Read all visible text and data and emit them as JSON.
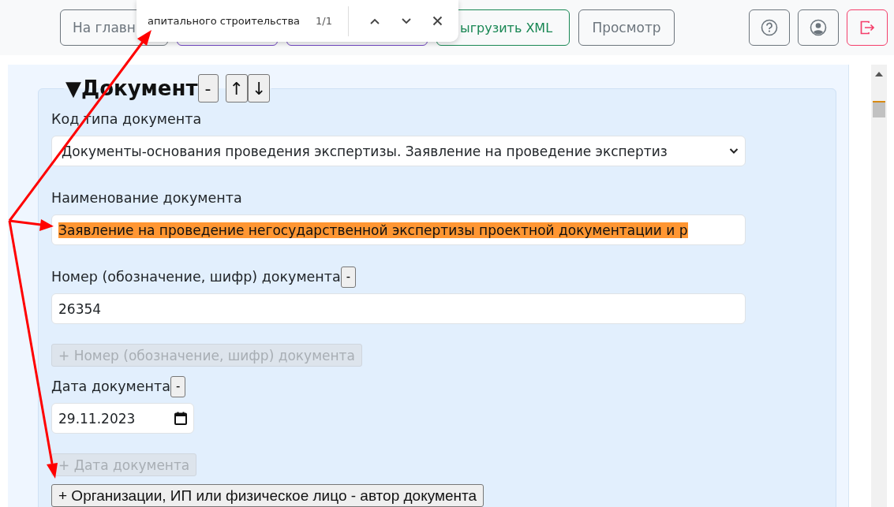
{
  "toolbar": {
    "buttons": [
      {
        "kind": "secondary",
        "label": "На главн"
      },
      {
        "kind": "primary"
      },
      {
        "kind": "primary"
      },
      {
        "kind": "success",
        "label": "ыгрузить XML"
      },
      {
        "kind": "secondary",
        "label": "Просмотр"
      }
    ],
    "icon_buttons": [
      {
        "kind": "help"
      },
      {
        "kind": "profile"
      },
      {
        "kind": "logout"
      }
    ]
  },
  "find_bar": {
    "query": "апитального строительства",
    "count": "1/1"
  },
  "section": {
    "toggle": "▼",
    "title": "Документ",
    "controls": [
      "-",
      "↑",
      "↓"
    ]
  },
  "fields": [
    {
      "kind": "select",
      "label": "Код типа документа",
      "value": "Документы-основания проведения экспертизы. Заявление на проведение экспертиз"
    },
    {
      "kind": "text",
      "label": "Наименование документа",
      "value": "Заявление на проведение негосударственной экспертизы проектной документации и р",
      "highlighted": true
    },
    {
      "kind": "text",
      "label": "Номер (обозначение, шифр) документа",
      "remove": "-",
      "value": "26354",
      "highlighted": false
    },
    {
      "kind": "add",
      "label": "+ Номер (обозначение, шифр) документа",
      "disabled": true
    },
    {
      "kind": "date",
      "label": "Дата документа",
      "remove": "-",
      "value": "29.11.2023"
    },
    {
      "kind": "add",
      "label": "+ Дата документа",
      "disabled": true
    },
    {
      "kind": "add",
      "label": "+ Организации, ИП или физическое лицо - автор документа",
      "disabled": false
    }
  ]
}
